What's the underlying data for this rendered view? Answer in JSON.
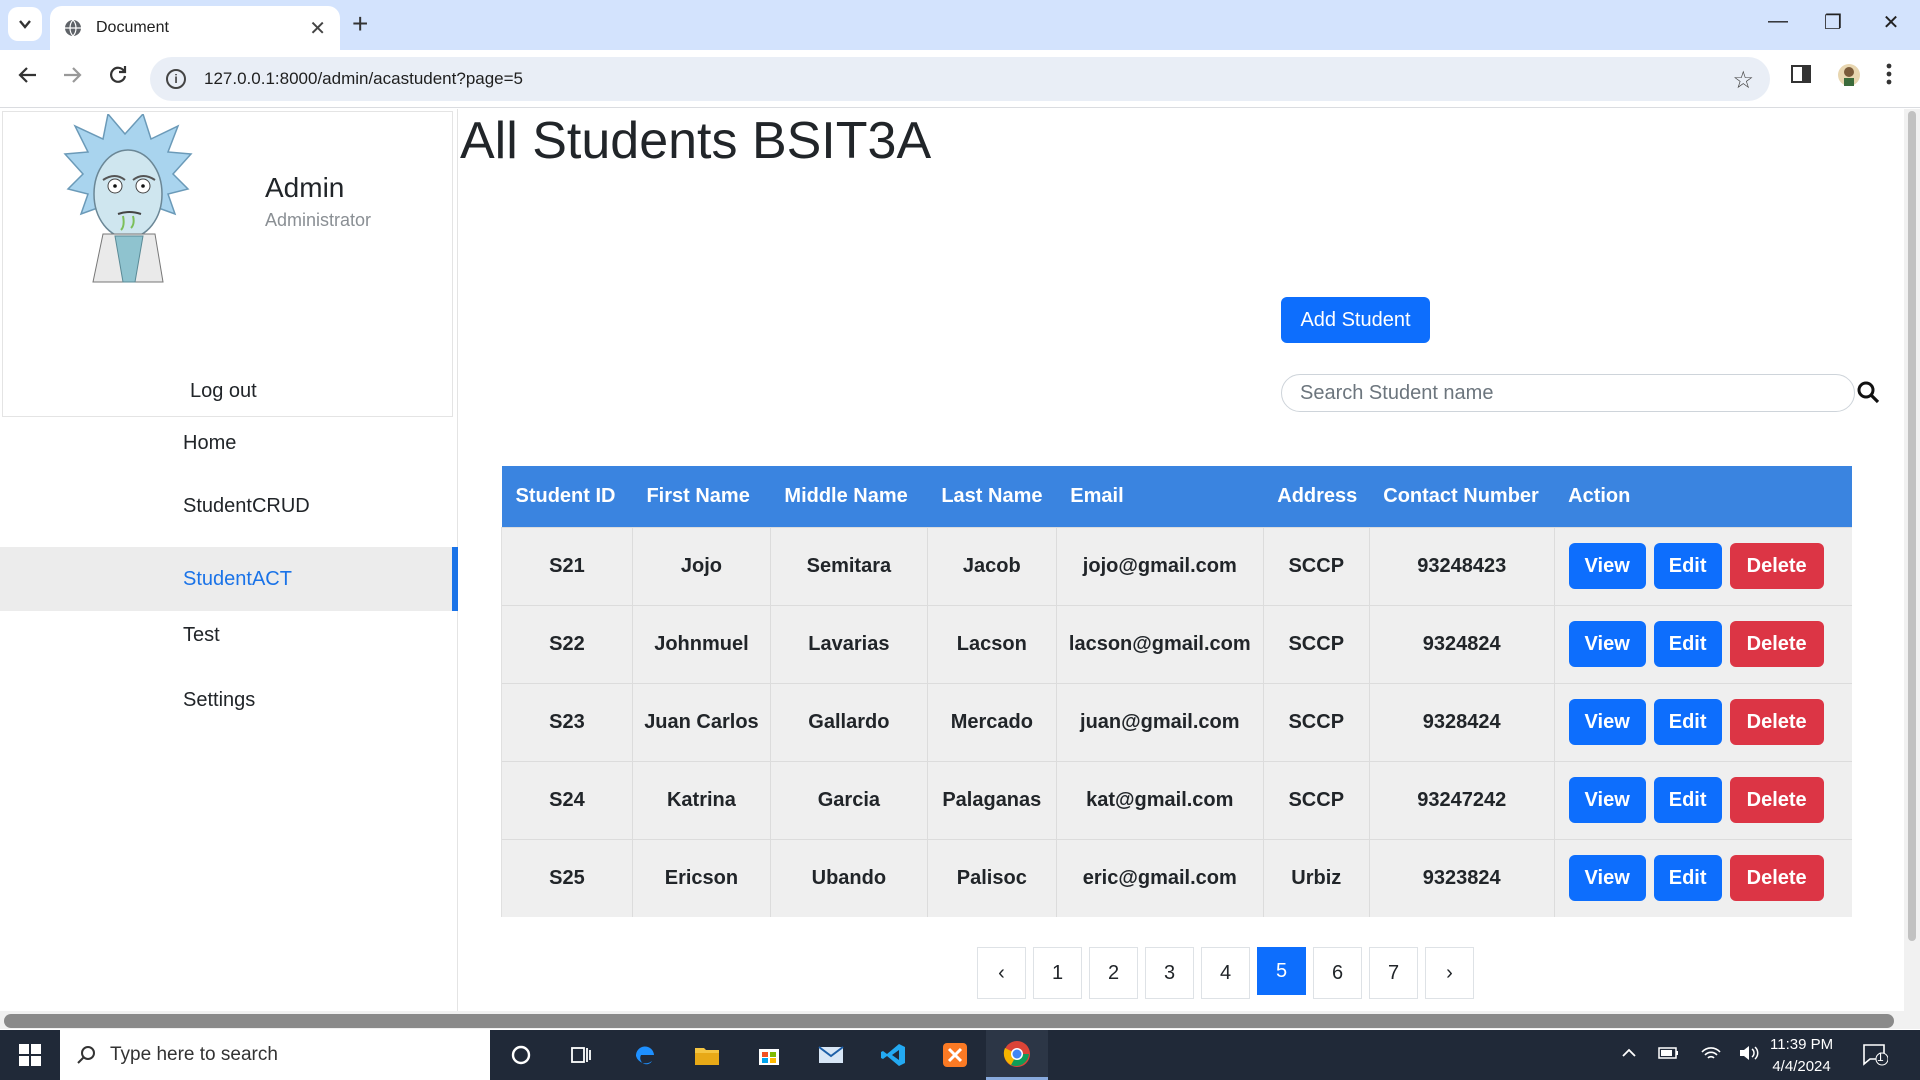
{
  "browser": {
    "tab_title": "Document",
    "tab_close": "✕",
    "new_tab": "+",
    "url": "127.0.0.1:8000/admin/acastudent?page=5",
    "window_controls": {
      "minimize": "—",
      "maximize": "❐",
      "close": "✕"
    }
  },
  "sidebar": {
    "admin_name": "Admin",
    "admin_role": "Administrator",
    "logout": "Log out",
    "items": [
      {
        "label": "Home"
      },
      {
        "label": "StudentCRUD"
      },
      {
        "label": "StudentACT",
        "active": true
      },
      {
        "label": "Test"
      },
      {
        "label": "Settings"
      }
    ]
  },
  "main": {
    "title": "All Students BSIT3A",
    "add_button": "Add Student",
    "search_placeholder": "Search Student name"
  },
  "table": {
    "headers": [
      "Student ID",
      "First Name",
      "Middle Name",
      "Last Name",
      "Email",
      "Address",
      "Contact Number",
      "Action"
    ],
    "rows": [
      {
        "id": "S21",
        "first": "Jojo",
        "middle": "Semitara",
        "last": "Jacob",
        "email": "jojo@gmail.com",
        "address": "SCCP",
        "contact": "93248423"
      },
      {
        "id": "S22",
        "first": "Johnmuel",
        "middle": "Lavarias",
        "last": "Lacson",
        "email": "lacson@gmail.com",
        "address": "SCCP",
        "contact": "9324824"
      },
      {
        "id": "S23",
        "first": "Juan Carlos",
        "middle": "Gallardo",
        "last": "Mercado",
        "email": "juan@gmail.com",
        "address": "SCCP",
        "contact": "9328424"
      },
      {
        "id": "S24",
        "first": "Katrina",
        "middle": "Garcia",
        "last": "Palaganas",
        "email": "kat@gmail.com",
        "address": "SCCP",
        "contact": "93247242"
      },
      {
        "id": "S25",
        "first": "Ericson",
        "middle": "Ubando",
        "last": "Palisoc",
        "email": "eric@gmail.com",
        "address": "Urbiz",
        "contact": "9323824"
      }
    ],
    "actions": {
      "view": "View",
      "edit": "Edit",
      "delete": "Delete"
    }
  },
  "pagination": {
    "prev": "‹",
    "next": "›",
    "pages": [
      "1",
      "2",
      "3",
      "4",
      "5",
      "6",
      "7"
    ],
    "current": "5"
  },
  "taskbar": {
    "search_placeholder": "Type here to search",
    "time": "11:39 PM",
    "date": "4/4/2024",
    "notification_count": "1"
  },
  "colors": {
    "primary": "#0d6efd",
    "danger": "#dc3545",
    "table_header": "#3a84e0",
    "active_nav": "#1a73e8"
  }
}
